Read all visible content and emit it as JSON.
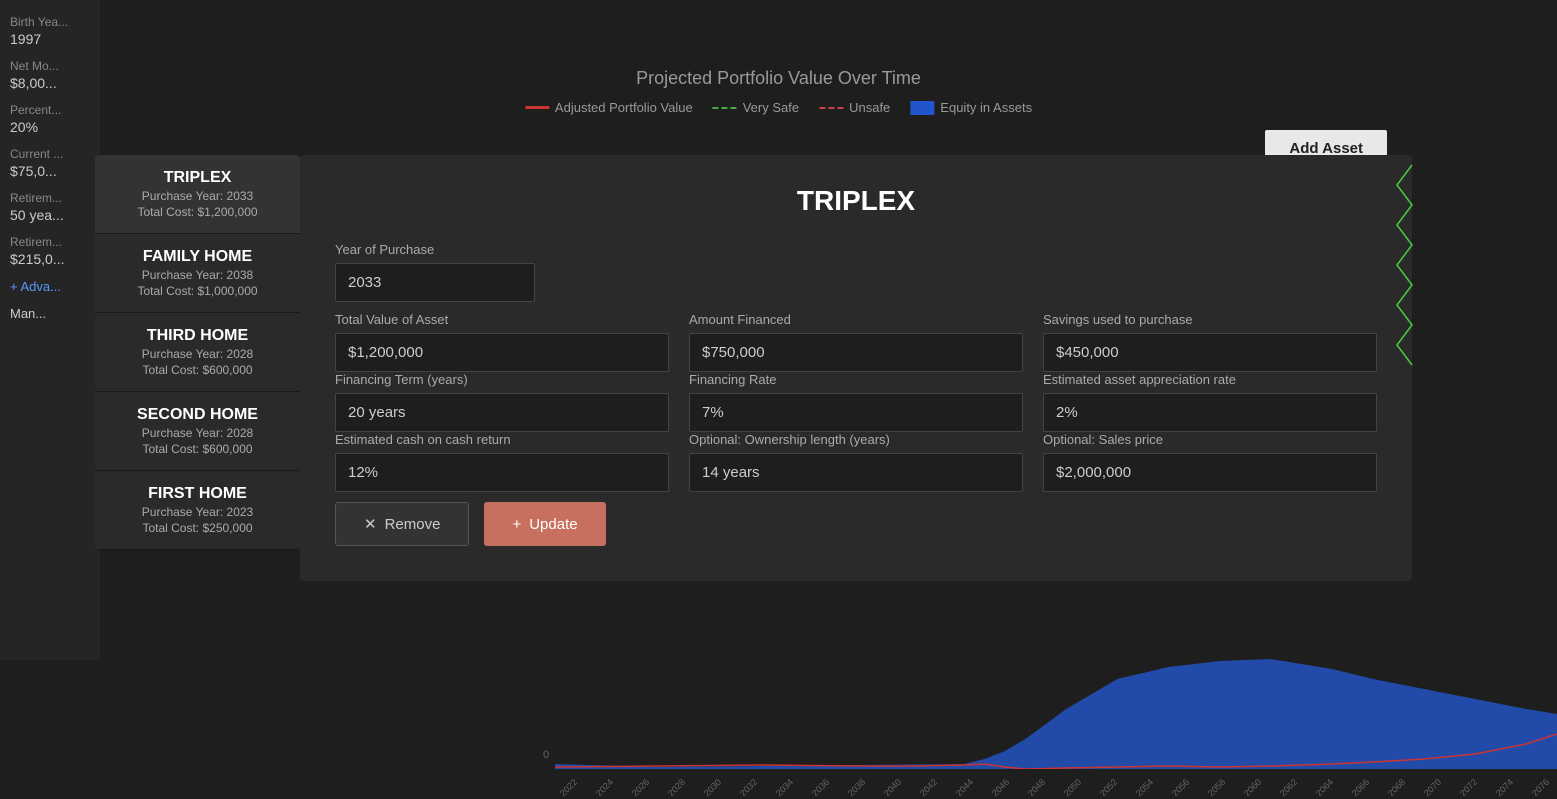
{
  "chart": {
    "title": "Projected Portfolio Value Over Time",
    "legend": [
      {
        "label": "Adjusted Portfolio Value",
        "type": "red-solid"
      },
      {
        "label": "Very Safe",
        "type": "green-dashed"
      },
      {
        "label": "Unsafe",
        "type": "red-dashed"
      },
      {
        "label": "Equity in Assets",
        "type": "blue-box"
      }
    ],
    "zero_label": "0",
    "x_labels": [
      "2022",
      "2024",
      "2026",
      "2028",
      "2030",
      "2032",
      "2034",
      "2036",
      "2038",
      "2040",
      "2042",
      "2044",
      "2046",
      "2048",
      "2050",
      "2052",
      "2054",
      "2056",
      "2058",
      "2060",
      "2062",
      "2064",
      "2066",
      "2068",
      "2070",
      "2072",
      "2074",
      "2076"
    ]
  },
  "sidebar": {
    "birth_year_label": "Birth Yea...",
    "birth_year_value": "1997",
    "net_monthly_label": "Net Mo...",
    "net_monthly_value": "$8,00...",
    "percentage_label": "Percent...",
    "percentage_value": "20%",
    "current_label": "Current ...",
    "current_value": "$75,0...",
    "retirement_age_label": "Retirem...",
    "retirement_age_value": "50 yea...",
    "retirement_savings_label": "Retirem...",
    "retirement_savings_value": "$215,0...",
    "advanced_label": "+ Adva...",
    "manage_label": "Man..."
  },
  "add_asset_button": "Add Asset",
  "assets": [
    {
      "name": "TRIPLEX",
      "purchase_year_label": "Purchase Year:",
      "purchase_year": "2033",
      "total_cost_label": "Total Cost:",
      "total_cost": "$1,200,000",
      "active": true
    },
    {
      "name": "FAMILY HOME",
      "purchase_year_label": "Purchase Year:",
      "purchase_year": "2038",
      "total_cost_label": "Total Cost:",
      "total_cost": "$1,000,000",
      "active": false
    },
    {
      "name": "THIRD HOME",
      "purchase_year_label": "Purchase Year:",
      "purchase_year": "2028",
      "total_cost_label": "Total Cost:",
      "total_cost": "$600,000",
      "active": false
    },
    {
      "name": "SECOND HOME",
      "purchase_year_label": "Purchase Year:",
      "purchase_year": "2028",
      "total_cost_label": "Total Cost:",
      "total_cost": "$600,000",
      "active": false
    },
    {
      "name": "FIRST HOME",
      "purchase_year_label": "Purchase Year:",
      "purchase_year": "2023",
      "total_cost_label": "Total Cost:",
      "total_cost": "$250,000",
      "active": false
    }
  ],
  "modal": {
    "title": "TRIPLEX",
    "year_of_purchase_label": "Year of Purchase",
    "year_of_purchase_value": "2033",
    "total_value_label": "Total Value of Asset",
    "total_value": "$1,200,000",
    "amount_financed_label": "Amount Financed",
    "amount_financed": "$750,000",
    "savings_label": "Savings used to purchase",
    "savings_value": "$450,000",
    "financing_term_label": "Financing Term (years)",
    "financing_term": "20 years",
    "financing_rate_label": "Financing Rate",
    "financing_rate": "7%",
    "appreciation_rate_label": "Estimated asset appreciation rate",
    "appreciation_rate": "2%",
    "cash_return_label": "Estimated cash on cash return",
    "cash_return": "12%",
    "ownership_length_label": "Optional: Ownership length (years)",
    "ownership_length": "14 years",
    "sales_price_label": "Optional: Sales price",
    "sales_price": "$2,000,000",
    "remove_button": "Remove",
    "update_button": "Update"
  }
}
